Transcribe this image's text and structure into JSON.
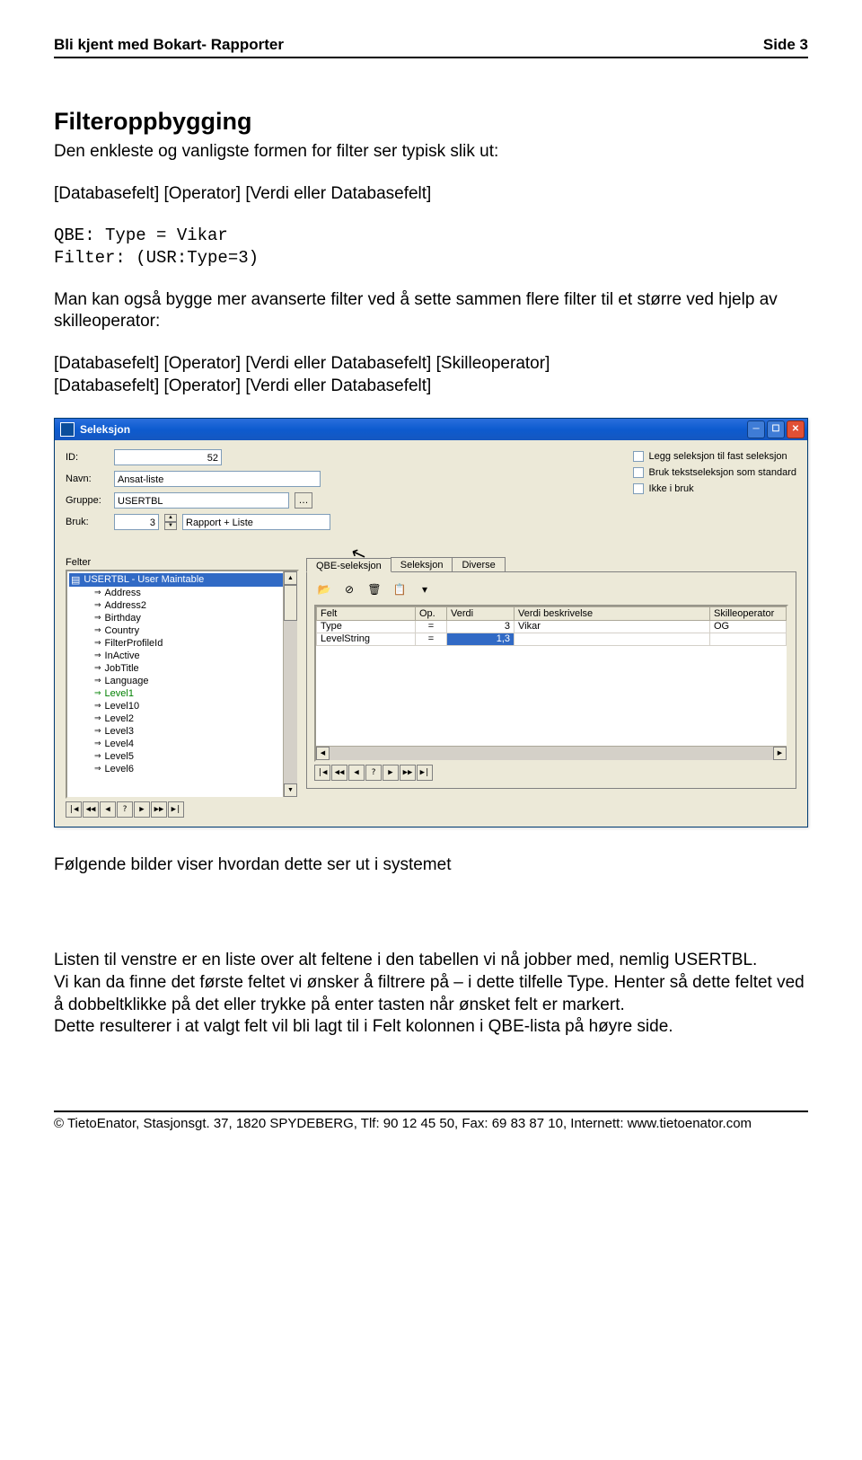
{
  "header": {
    "left": "Bli kjent med Bokart- Rapporter",
    "right": "Side 3"
  },
  "section": {
    "title": "Filteroppbygging",
    "intro": "Den enkleste og vanligste formen for filter ser typisk slik ut:",
    "line1": "[Databasefelt] [Operator] [Verdi eller Databasefelt]",
    "qbe": "QBE:  Type = Vikar",
    "filter": "Filter:  (USR:Type=3)",
    "para2a": "Man kan også bygge mer avanserte filter ved å sette sammen flere filter til et større ved hjelp av skilleoperator:",
    "line2a": "[Databasefelt] [Operator] [Verdi eller Databasefelt] [Skilleoperator]",
    "line2b": "[Databasefelt] [Operator] [Verdi eller Databasefelt]",
    "after_img": "Følgende bilder viser hvordan dette ser ut i systemet",
    "list_para": "Listen til venstre er en liste over alt feltene i den tabellen vi nå jobber med, nemlig USERTBL.",
    "body_final": "Vi kan da finne det første feltet vi ønsker å filtrere på – i dette tilfelle Type. Henter så dette feltet ved å dobbeltklikke på det eller trykke på enter tasten når ønsket felt er markert.",
    "body_final2": "Dette resulterer i at valgt felt vil bli lagt til i Felt kolonnen i QBE-lista på høyre side."
  },
  "window": {
    "title": "Seleksjon",
    "form": {
      "id_label": "ID:",
      "id_value": "52",
      "navn_label": "Navn:",
      "navn_value": "Ansat-liste",
      "gruppe_label": "Gruppe:",
      "gruppe_value": "USERTBL",
      "bruk_label": "Bruk:",
      "bruk_num": "3",
      "bruk_text": "Rapport + Liste"
    },
    "checks": {
      "c1": "Legg seleksjon til fast seleksjon",
      "c2": "Bruk tekstseleksjon som standard",
      "c3": "Ikke i bruk"
    },
    "left_panel": {
      "label": "Felter",
      "root": "USERTBL - User Maintable",
      "items": [
        "Address",
        "Address2",
        "Birthday",
        "Country",
        "FilterProfileId",
        "InActive",
        "JobTitle",
        "Language",
        "Level1",
        "Level10",
        "Level2",
        "Level3",
        "Level4",
        "Level5",
        "Level6"
      ]
    },
    "tabs": {
      "t1": "QBE-seleksjon",
      "t2": "Seleksjon",
      "t3": "Diverse"
    },
    "grid": {
      "cols": {
        "c1": "Felt",
        "c2": "Op.",
        "c3": "Verdi",
        "c4": "Verdi beskrivelse",
        "c5": "Skilleoperator"
      },
      "rows": [
        {
          "felt": "Type",
          "op": "=",
          "verdi": "3",
          "besk": "Vikar",
          "skille": "OG"
        },
        {
          "felt": "LevelString",
          "op": "=",
          "verdi": "1,3",
          "besk": "",
          "skille": ""
        }
      ]
    }
  },
  "footer": "© TietoEnator, Stasjonsgt. 37, 1820 SPYDEBERG, Tlf: 90 12 45 50, Fax: 69 83 87 10, Internett: www.tietoenator.com"
}
